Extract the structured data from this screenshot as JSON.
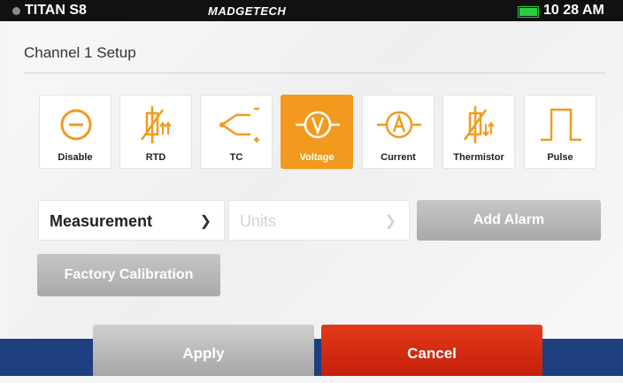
{
  "status_bar": {
    "device": "TITAN S8",
    "brand": "MADGETECH",
    "time": "10 28 AM"
  },
  "page": {
    "title": "Channel 1 Setup"
  },
  "sensor_types": [
    {
      "label": "Disable",
      "icon": "minus-circle-icon",
      "selected": false
    },
    {
      "label": "RTD",
      "icon": "rtd-icon",
      "selected": false
    },
    {
      "label": "TC",
      "icon": "thermocouple-icon",
      "selected": false
    },
    {
      "label": "Voltage",
      "icon": "voltmeter-icon",
      "selected": true
    },
    {
      "label": "Current",
      "icon": "ammeter-icon",
      "selected": false
    },
    {
      "label": "Thermistor",
      "icon": "thermistor-icon",
      "selected": false
    },
    {
      "label": "Pulse",
      "icon": "pulse-icon",
      "selected": false
    }
  ],
  "settings": {
    "measurement_label": "Measurement",
    "units_label": "Units",
    "add_alarm_label": "Add Alarm",
    "factory_calibration_label": "Factory Calibration"
  },
  "footer": {
    "apply_label": "Apply",
    "cancel_label": "Cancel"
  },
  "colors": {
    "accent": "#f39a1e",
    "cancel": "#d42a12",
    "bar": "#1d3f7e"
  }
}
